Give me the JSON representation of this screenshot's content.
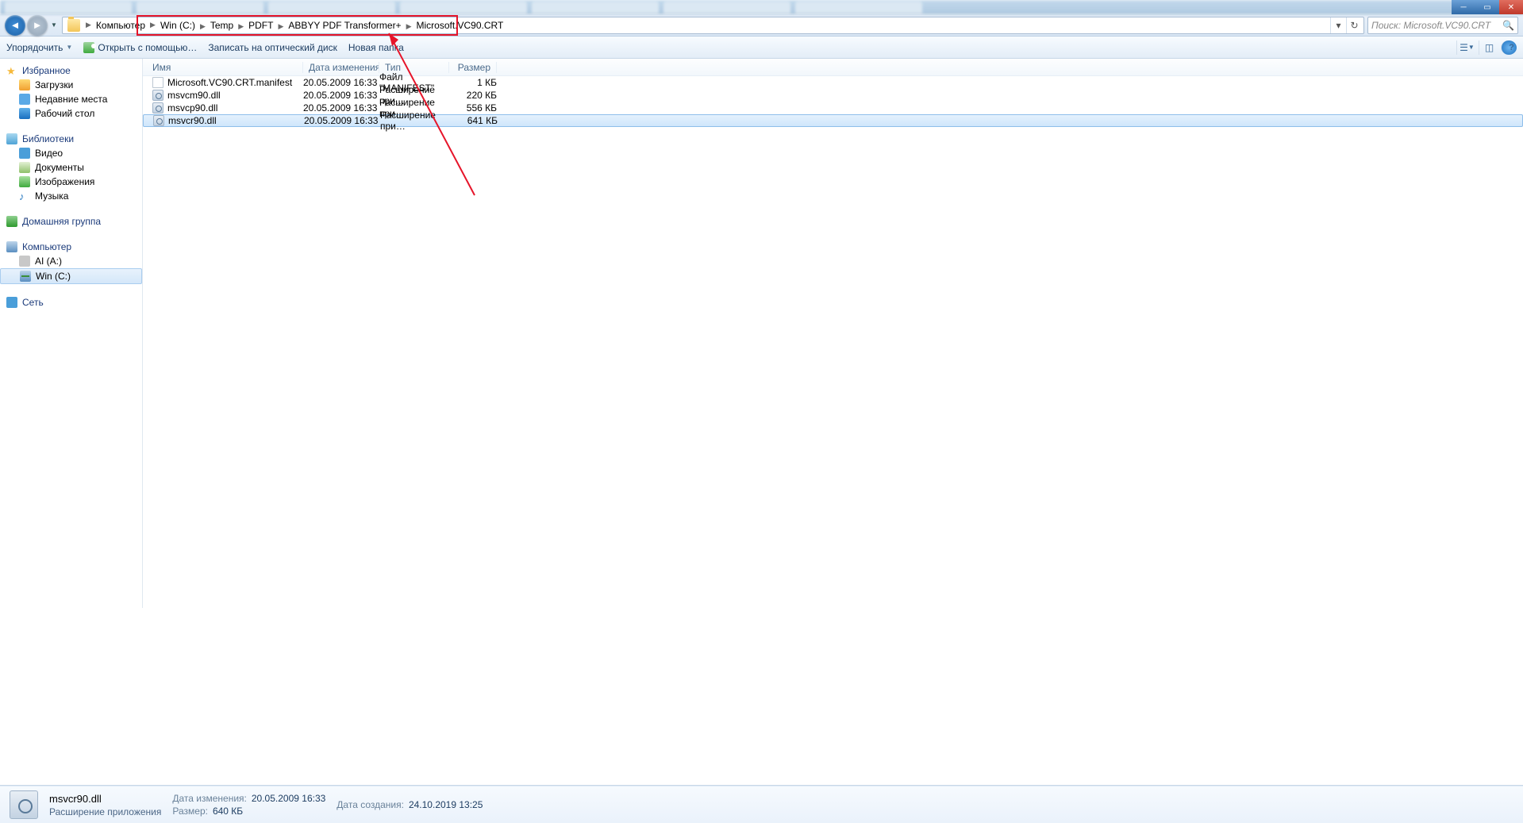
{
  "breadcrumb": {
    "root": "Компьютер",
    "parts": [
      "Win (C:)",
      "Temp",
      "PDFT",
      "ABBYY PDF Transformer+",
      "Microsoft.VC90.CRT"
    ]
  },
  "search_placeholder": "Поиск: Microsoft.VC90.CRT",
  "toolbar": {
    "organize": "Упорядочить",
    "open_with": "Открыть с помощью…",
    "burn": "Записать на оптический диск",
    "new_folder": "Новая папка"
  },
  "columns": {
    "name": "Имя",
    "date": "Дата изменения",
    "type": "Тип",
    "size": "Размер"
  },
  "sidebar": {
    "favorites": "Избранное",
    "favorites_items": [
      {
        "label": "Загрузки",
        "ico": "i-dl"
      },
      {
        "label": "Недавние места",
        "ico": "i-recent"
      },
      {
        "label": "Рабочий стол",
        "ico": "i-desktop"
      }
    ],
    "libraries": "Библиотеки",
    "libraries_items": [
      {
        "label": "Видео",
        "ico": "i-video"
      },
      {
        "label": "Документы",
        "ico": "i-doc"
      },
      {
        "label": "Изображения",
        "ico": "i-img"
      },
      {
        "label": "Музыка",
        "ico": "i-music",
        "glyph": "♪"
      }
    ],
    "homegroup": "Домашняя группа",
    "computer": "Компьютер",
    "computer_items": [
      {
        "label": "AI (A:)",
        "ico": "i-driveA"
      },
      {
        "label": "Win (C:)",
        "ico": "i-driveC",
        "sel": true
      }
    ],
    "network": "Сеть"
  },
  "files": [
    {
      "name": "Microsoft.VC90.CRT.manifest",
      "date": "20.05.2009 16:33",
      "type": "Файл \"MANIFEST\"",
      "size": "1 КБ",
      "ico": "file-ico"
    },
    {
      "name": "msvcm90.dll",
      "date": "20.05.2009 16:33",
      "type": "Расширение при…",
      "size": "220 КБ",
      "ico": "dll-ico"
    },
    {
      "name": "msvcp90.dll",
      "date": "20.05.2009 16:33",
      "type": "Расширение при…",
      "size": "556 КБ",
      "ico": "dll-ico"
    },
    {
      "name": "msvcr90.dll",
      "date": "20.05.2009 16:33",
      "type": "Расширение при…",
      "size": "641 КБ",
      "ico": "dll-ico",
      "sel": true
    }
  ],
  "details": {
    "name": "msvcr90.dll",
    "desc": "Расширение приложения",
    "mod_label": "Дата изменения:",
    "mod": "20.05.2009 16:33",
    "size_label": "Размер:",
    "size": "640 КБ",
    "created_label": "Дата создания:",
    "created": "24.10.2019 13:25"
  },
  "red_box_width": 405
}
